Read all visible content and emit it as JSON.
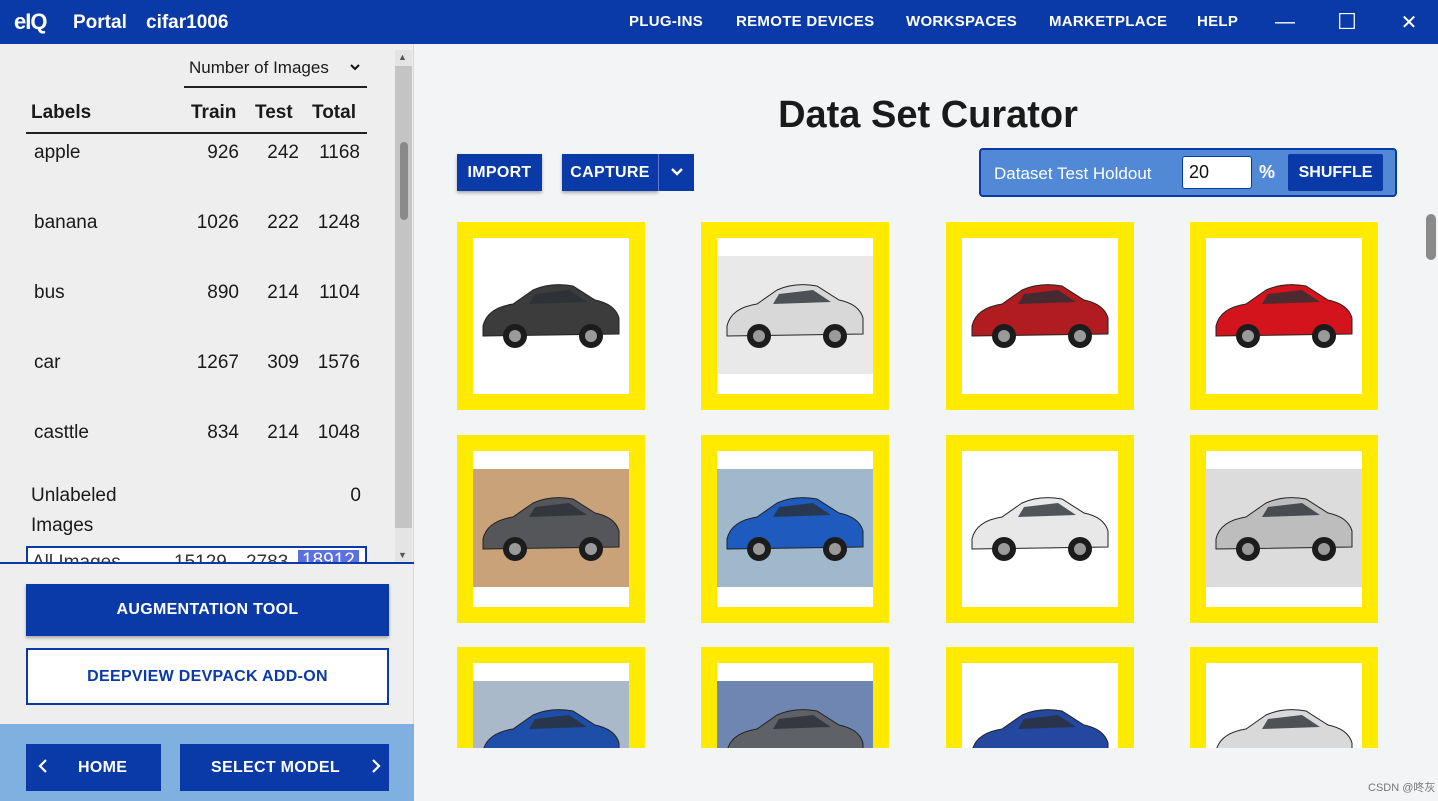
{
  "app": {
    "logo": "eIQ",
    "portal_label": "Portal",
    "project_name": "cifar1006",
    "brand_color": "#0a3aa8"
  },
  "nav": {
    "items": [
      "PLUG-INS",
      "REMOTE DEVICES",
      "WORKSPACES",
      "MARKETPLACE",
      "HELP"
    ]
  },
  "window_controls": {
    "minimize": "—",
    "maximize": "☐",
    "close": "✕"
  },
  "labels_panel": {
    "sort_by": "Number of Images",
    "headers": {
      "labels": "Labels",
      "train": "Train",
      "test": "Test",
      "total": "Total"
    },
    "rows": [
      {
        "label": "apple",
        "train": "926",
        "test": "242",
        "total": "1168"
      },
      {
        "label": "banana",
        "train": "1026",
        "test": "222",
        "total": "1248"
      },
      {
        "label": "bus",
        "train": "890",
        "test": "214",
        "total": "1104"
      },
      {
        "label": "car",
        "train": "1267",
        "test": "309",
        "total": "1576"
      },
      {
        "label": "casttle",
        "train": "834",
        "test": "214",
        "total": "1048"
      }
    ],
    "unlabeled": {
      "label": "Unlabeled Images",
      "value": "0"
    },
    "all_images": {
      "label": "All Images",
      "train": "15129",
      "test": "2783",
      "total": "18912"
    }
  },
  "left_buttons": {
    "augmentation": "AUGMENTATION TOOL",
    "devpack": "DEEPVIEW DEVPACK ADD-ON",
    "home": "HOME",
    "select_model": "SELECT MODEL"
  },
  "curator": {
    "title": "Data Set Curator",
    "import_label": "IMPORT",
    "capture_label": "CAPTURE",
    "holdout_label": "Dataset Test Holdout",
    "holdout_value": "20",
    "percent_sign": "%",
    "shuffle_label": "SHUFFLE",
    "tile_border_color": "#ffea00"
  },
  "images": [
    {
      "name": "car-image-1",
      "color": "#3c3c3c",
      "bg": "#ffffff"
    },
    {
      "name": "car-image-2",
      "color": "#d8d8d8",
      "bg": "#e9e9e9"
    },
    {
      "name": "car-image-3",
      "color": "#b01c20",
      "bg": "#ffffff"
    },
    {
      "name": "car-image-4",
      "color": "#d4141c",
      "bg": "#ffffff"
    },
    {
      "name": "car-image-5",
      "color": "#55565a",
      "bg": "#c9a27a"
    },
    {
      "name": "car-image-6",
      "color": "#1f5bbf",
      "bg": "#9fb8cc"
    },
    {
      "name": "car-image-7",
      "color": "#e8e8e8",
      "bg": "#ffffff"
    },
    {
      "name": "car-image-8",
      "color": "#bdbdbd",
      "bg": "#dcdcdc"
    },
    {
      "name": "car-image-9",
      "color": "#1d4fa8",
      "bg": "#a9b9c9"
    },
    {
      "name": "car-image-10",
      "color": "#5e6266",
      "bg": "#6f86b3"
    },
    {
      "name": "car-image-11",
      "color": "#2447a0",
      "bg": "#ffffff"
    },
    {
      "name": "car-image-12",
      "color": "#d9d9d9",
      "bg": "#ffffff"
    }
  ],
  "watermark": "CSDN @咚灰"
}
